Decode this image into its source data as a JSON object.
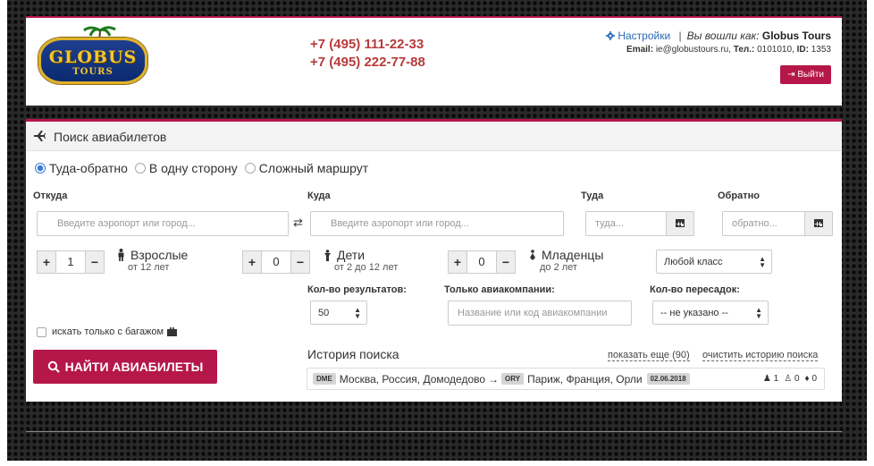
{
  "header": {
    "logo": {
      "title": "GLOBUS",
      "subtitle": "TOURS"
    },
    "phones": [
      "+7 (495) 111-22-33",
      "+7 (495) 222-77-88"
    ],
    "settings_label": "Настройки",
    "logged_as_label": "Вы вошли как:",
    "account_name": "Globus Tours",
    "email_label": "Email:",
    "email": "ie@globustours.ru,",
    "phone_label": "Тел.:",
    "phone": "0101010,",
    "id_label": "ID:",
    "id": "1353",
    "logout_label": "Выйти"
  },
  "search": {
    "title": "Поиск авиабилетов",
    "trip_types": [
      "Туда-обратно",
      "В одну сторону",
      "Сложный маршрут"
    ],
    "selected_trip_type": "Туда-обратно",
    "from_label": "Откуда",
    "from_placeholder": "Введите аэропорт или город...",
    "to_label": "Куда",
    "to_placeholder": "Введите аэропорт или город...",
    "depart_label": "Туда",
    "depart_placeholder": "туда...",
    "return_label": "Обратно",
    "return_placeholder": "обратно...",
    "passengers": [
      {
        "name": "Взрослые",
        "age": "от 12 лет",
        "count": "1"
      },
      {
        "name": "Дети",
        "age": "от 2 до 12 лет",
        "count": "0"
      },
      {
        "name": "Младенцы",
        "age": "до 2 лет",
        "count": "0"
      }
    ],
    "class_select": "Любой класс",
    "results_label": "Кол-во результатов:",
    "results_value": "50",
    "airlines_label": "Только авиакомпании:",
    "airlines_placeholder": "Название или код авиакомпании",
    "transfers_label": "Кол-во пересадок:",
    "transfers_value": "-- не указано --",
    "baggage_label": "искать только с багажом",
    "find_button": "НАЙТИ АВИАБИЛЕТЫ"
  },
  "history": {
    "title": "История поиска",
    "show_more": "показать еще (90)",
    "clear": "очистить историю поиска",
    "items": [
      {
        "from_code": "DME",
        "from_name": "Москва, Россия, Домодедово",
        "arrow": "→",
        "to_code": "ORY",
        "to_name": "Париж, Франция, Орли",
        "date": "02.06.2018",
        "adults": "1",
        "children": "0",
        "infants": "0"
      }
    ]
  },
  "colors": {
    "accent": "#b5174a",
    "phone": "#b83a3a",
    "link": "#2a6ab3"
  }
}
